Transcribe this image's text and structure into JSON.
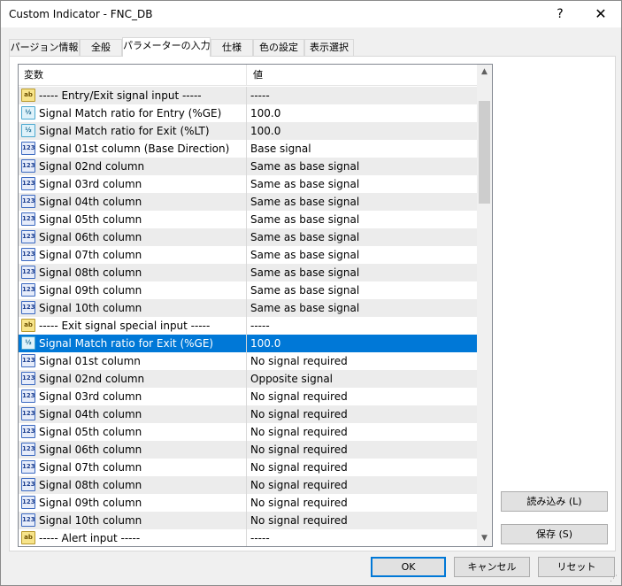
{
  "window": {
    "title": "Custom Indicator - FNC_DB",
    "help_label": "?",
    "close_label": "✕"
  },
  "tabs": [
    {
      "label": "パージョン情報"
    },
    {
      "label": "全般"
    },
    {
      "label": "パラメーターの入力"
    },
    {
      "label": "仕様"
    },
    {
      "label": "色の設定"
    },
    {
      "label": "表示選択"
    }
  ],
  "grid": {
    "header_variable": "変数",
    "header_value": "値",
    "rows": [
      {
        "icon": "ab",
        "variable": "----- Entry/Exit signal input -----",
        "value": "-----"
      },
      {
        "icon": "dbl",
        "variable": "Signal Match ratio for Entry (%GE)",
        "value": "100.0"
      },
      {
        "icon": "dbl",
        "variable": "Signal Match ratio for Exit (%LT)",
        "value": "100.0"
      },
      {
        "icon": "enum",
        "variable": "Signal 01st column (Base Direction)",
        "value": "Base signal"
      },
      {
        "icon": "enum",
        "variable": "Signal 02nd column",
        "value": "Same as base signal"
      },
      {
        "icon": "enum",
        "variable": "Signal 03rd column",
        "value": "Same as base signal"
      },
      {
        "icon": "enum",
        "variable": "Signal 04th column",
        "value": "Same as base signal"
      },
      {
        "icon": "enum",
        "variable": "Signal 05th column",
        "value": "Same as base signal"
      },
      {
        "icon": "enum",
        "variable": "Signal 06th column",
        "value": "Same as base signal"
      },
      {
        "icon": "enum",
        "variable": "Signal 07th column",
        "value": "Same as base signal"
      },
      {
        "icon": "enum",
        "variable": "Signal 08th column",
        "value": "Same as base signal"
      },
      {
        "icon": "enum",
        "variable": "Signal 09th column",
        "value": "Same as base signal"
      },
      {
        "icon": "enum",
        "variable": "Signal 10th column",
        "value": "Same as base signal"
      },
      {
        "icon": "ab",
        "variable": "----- Exit signal special input -----",
        "value": "-----"
      },
      {
        "icon": "dbl",
        "variable": "Signal Match ratio for Exit (%GE)",
        "value": "100.0",
        "selected": true
      },
      {
        "icon": "enum",
        "variable": "Signal 01st column",
        "value": "No signal required"
      },
      {
        "icon": "enum",
        "variable": "Signal 02nd column",
        "value": "Opposite signal"
      },
      {
        "icon": "enum",
        "variable": "Signal 03rd column",
        "value": "No signal required"
      },
      {
        "icon": "enum",
        "variable": "Signal 04th column",
        "value": "No signal required"
      },
      {
        "icon": "enum",
        "variable": "Signal 05th column",
        "value": "No signal required"
      },
      {
        "icon": "enum",
        "variable": "Signal 06th column",
        "value": "No signal required"
      },
      {
        "icon": "enum",
        "variable": "Signal 07th column",
        "value": "No signal required"
      },
      {
        "icon": "enum",
        "variable": "Signal 08th column",
        "value": "No signal required"
      },
      {
        "icon": "enum",
        "variable": "Signal 09th column",
        "value": "No signal required"
      },
      {
        "icon": "enum",
        "variable": "Signal 10th column",
        "value": "No signal required"
      },
      {
        "icon": "ab",
        "variable": "----- Alert input -----",
        "value": "-----"
      }
    ]
  },
  "icons": {
    "ab": {
      "name": "string-type-icon",
      "glyph": "ab"
    },
    "dbl": {
      "name": "double-type-icon",
      "glyph": "½"
    },
    "enum": {
      "name": "enum-type-icon",
      "glyph": "123"
    }
  },
  "scroll": {
    "up_glyph": "▲",
    "down_glyph": "▼"
  },
  "buttons": {
    "load": "読み込み (L)",
    "save": "保存 (S)",
    "ok": "OK",
    "cancel": "キャンセル",
    "reset": "リセット"
  },
  "colors": {
    "selection": "#0078d7",
    "row_alt": "#ececec"
  }
}
